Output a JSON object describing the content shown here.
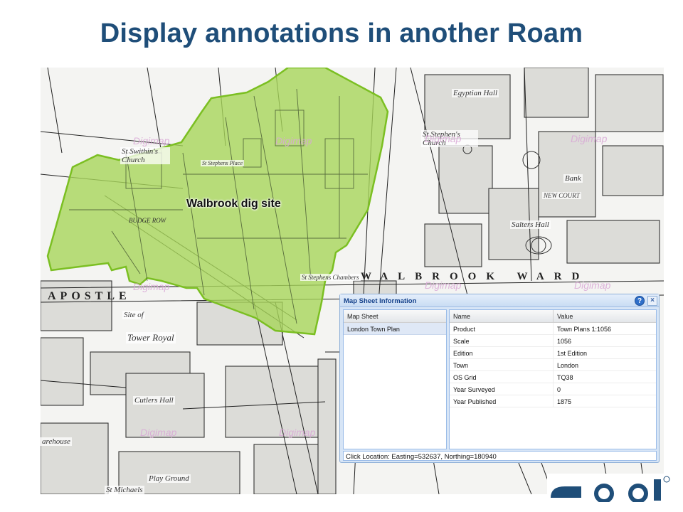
{
  "slide": {
    "title": "Display annotations in another Roam"
  },
  "map": {
    "annotation_label": "Walbrook dig site",
    "labels": {
      "apostle": "APOSTLE",
      "walbrook_ward": "WALBROOK WARD",
      "egyptian_hall": "Egyptian Hall",
      "st_stephens_church": "St Stephen's Church",
      "bank": "Bank",
      "new_court": "NEW COURT",
      "salters_hall": "Salters Hall",
      "st_swithins_church": "St Swithin's Church",
      "tower_royal": "Tower Royal",
      "site_of": "Site of",
      "cutlers_hall": "Cutlers Hall",
      "play_ground": "Play Ground",
      "st_michaels": "St Michaels",
      "budge_row": "BUDGE ROW",
      "warehouse": "arehouse",
      "st_stephens_chambers": "St Stephens Chambers",
      "stephens_place": "St Stephens Place"
    },
    "watermark": "Digimap",
    "colors": {
      "annotation_fill": "#a8d65a",
      "annotation_stroke": "#7bbf22"
    }
  },
  "window": {
    "title": "Map Sheet Information",
    "help_icon": "?",
    "close_icon": "×",
    "left_panel": {
      "header": "Map Sheet",
      "rows": [
        "London Town Plan"
      ]
    },
    "right_panel": {
      "headers": {
        "name": "Name",
        "value": "Value"
      },
      "rows": [
        {
          "name": "Product",
          "value": "Town Plans 1:1056"
        },
        {
          "name": "Scale",
          "value": "1056"
        },
        {
          "name": "Edition",
          "value": "1st Edition"
        },
        {
          "name": "Town",
          "value": "London"
        },
        {
          "name": "OS Grid",
          "value": "TQ38"
        },
        {
          "name": "Year Surveyed",
          "value": "0"
        },
        {
          "name": "Year Published",
          "value": "1875"
        }
      ]
    },
    "status": "Click Location: Easting=532637, Northing=180940"
  }
}
